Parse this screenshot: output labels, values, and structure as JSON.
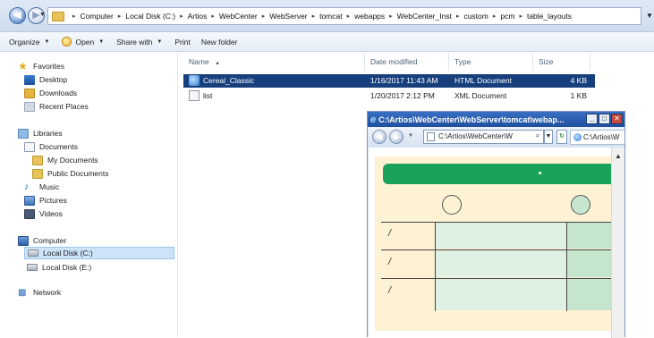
{
  "address": {
    "crumbs": [
      "Computer",
      "Local Disk (C:)",
      "Artios",
      "WebCenter",
      "WebServer",
      "tomcat",
      "webapps",
      "WebCenter_Inst",
      "custom",
      "pcm",
      "table_layouts"
    ]
  },
  "toolbar": {
    "organize": "Organize",
    "open": "Open",
    "share_with": "Share with",
    "print": "Print",
    "new_folder": "New folder"
  },
  "nav": {
    "favorites": "Favorites",
    "desktop": "Desktop",
    "downloads": "Downloads",
    "recent_places": "Recent Places",
    "libraries": "Libraries",
    "documents": "Documents",
    "my_documents": "My Documents",
    "public_documents": "Public Documents",
    "music": "Music",
    "pictures": "Pictures",
    "videos": "Videos",
    "computer": "Computer",
    "local_disk_c": "Local Disk (C:)",
    "local_disk_e": "Local Disk (E:)",
    "network": "Network"
  },
  "columns": {
    "name": "Name",
    "date_modified": "Date modified",
    "type": "Type",
    "size": "Size"
  },
  "files": [
    {
      "name": "Cereal_Classic",
      "date": "1/16/2017 11:43 AM",
      "type": "HTML Document",
      "size": "4 KB"
    },
    {
      "name": "list",
      "date": "1/20/2017 2:12 PM",
      "type": "XML Document",
      "size": "1 KB"
    }
  ],
  "ie": {
    "title": "C:\\Artios\\WebCenter\\WebServer\\tomcat\\webap...",
    "address": "C:\\Artios\\WebCenter\\W",
    "tab_label": "C:\\Artios\\W",
    "slashes": [
      "/",
      "/",
      "/"
    ]
  },
  "colors": {
    "selection": "#173f7c",
    "green_bar": "#1aa25a",
    "cream": "#fdf2d4",
    "light_green": "#dff1e2"
  }
}
